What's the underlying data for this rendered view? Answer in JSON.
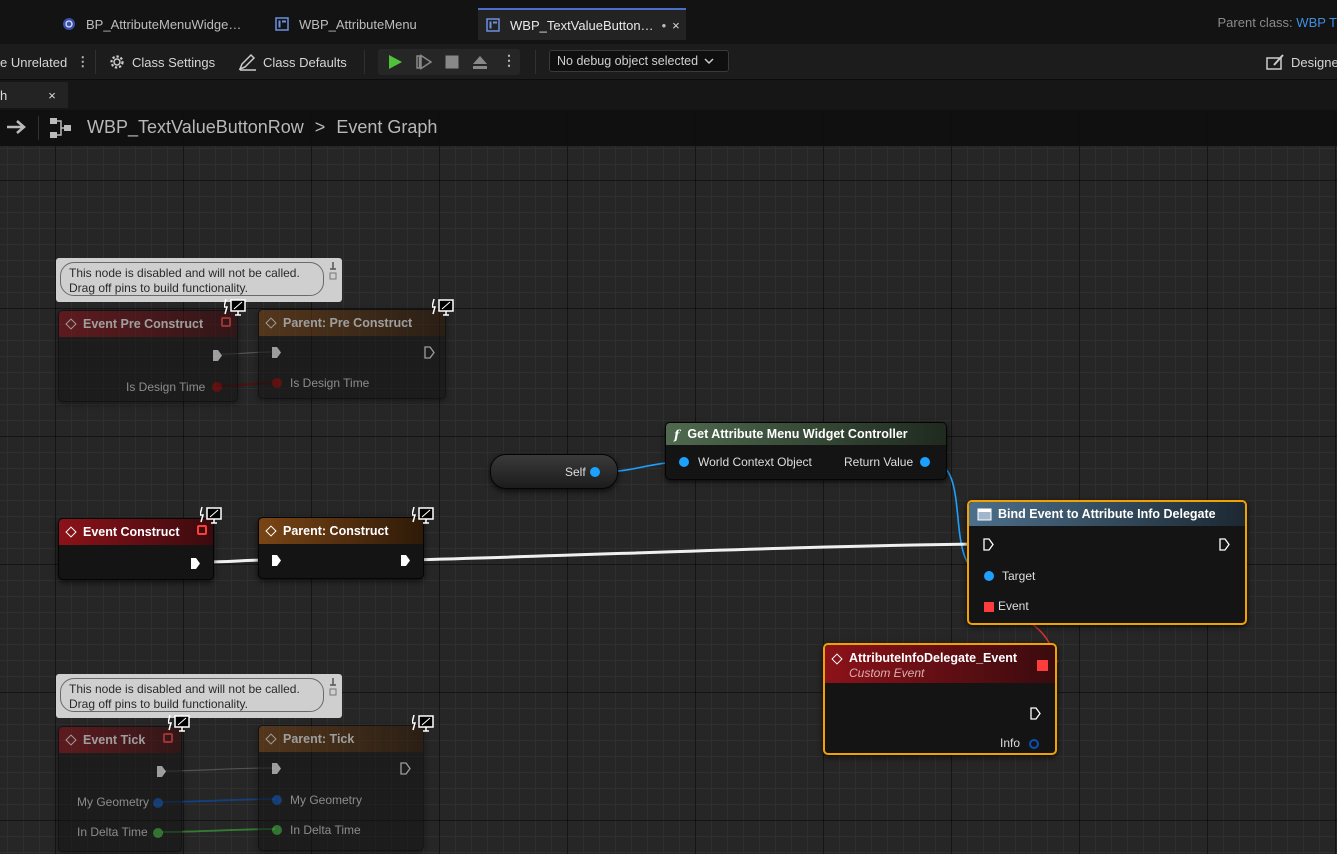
{
  "tabs": [
    {
      "label": "BP_AttributeMenuWidge…"
    },
    {
      "label": "WBP_AttributeMenu"
    },
    {
      "label": "WBP_TextValueButton…",
      "modified": "•",
      "close": "×"
    }
  ],
  "parent_class": {
    "label": "Parent class:",
    "value": "WBP T"
  },
  "toolbar": {
    "unrelated_label": "e Unrelated",
    "class_settings": "Class Settings",
    "class_defaults": "Class Defaults",
    "debug_select": "No debug object selected",
    "designer": "Designe"
  },
  "graph_tab": {
    "label": "h",
    "close": "×"
  },
  "breadcrumb": {
    "blueprint": "WBP_TextValueButtonRow",
    "separator": ">",
    "graph": "Event Graph"
  },
  "comments": [
    {
      "line1": "This node is disabled and will not be called.",
      "line2": "Drag off pins to build functionality."
    },
    {
      "line1": "This node is disabled and will not be called.",
      "line2": "Drag off pins to build functionality."
    }
  ],
  "nodes": {
    "event_pre_construct": {
      "title": "Event Pre Construct",
      "pin_is_design_time": "Is Design Time"
    },
    "parent_pre_construct": {
      "title": "Parent: Pre Construct",
      "pin_is_design_time": "Is Design Time"
    },
    "self": {
      "label": "Self"
    },
    "get_controller": {
      "title": "Get Attribute Menu Widget Controller",
      "pin_world_context": "World Context Object",
      "pin_return": "Return Value"
    },
    "event_construct": {
      "title": "Event Construct"
    },
    "parent_construct": {
      "title": "Parent: Construct"
    },
    "bind_event": {
      "title": "Bind Event to Attribute Info Delegate",
      "pin_target": "Target",
      "pin_event": "Event"
    },
    "custom_event": {
      "title": "AttributeInfoDelegate_Event",
      "subtitle": "Custom Event",
      "pin_info": "Info"
    },
    "event_tick": {
      "title": "Event Tick",
      "pin_geometry": "My Geometry",
      "pin_delta": "In Delta Time"
    },
    "parent_tick": {
      "title": "Parent: Tick",
      "pin_geometry": "My Geometry",
      "pin_delta": "In Delta Time"
    }
  },
  "colors": {
    "accent_blue": "#3f8fe0",
    "selection": "#f2a200",
    "event_red": "#8c1219",
    "object_pin": "#1ea0ff",
    "bool_pin": "#8e0000",
    "float_pin": "#3cb23c",
    "struct_pin": "#0a50b5",
    "delegate_pin": "#ff3c3c",
    "play_green": "#4fc13a"
  }
}
